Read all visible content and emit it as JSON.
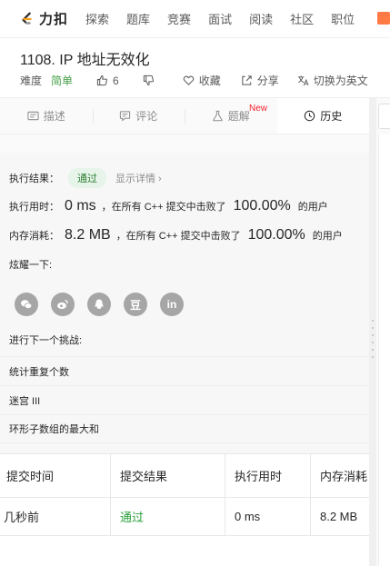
{
  "brand": {
    "name": "力扣"
  },
  "nav": {
    "items": [
      "探索",
      "题库",
      "竞赛",
      "面试",
      "阅读",
      "社区",
      "职位"
    ]
  },
  "problem": {
    "title": "1108. IP 地址无效化",
    "difficulty_label": "难度",
    "difficulty_value": "简单",
    "likes": "6",
    "favorite": "收藏",
    "share": "分享",
    "switch_lang": "切换为英文"
  },
  "tabs": [
    {
      "label": "描述",
      "icon": "description-icon"
    },
    {
      "label": "评论",
      "icon": "comment-icon"
    },
    {
      "label": "题解",
      "icon": "flask-icon",
      "badge": "New"
    },
    {
      "label": "历史",
      "icon": "clock-icon"
    }
  ],
  "result": {
    "status_label": "执行结果：",
    "status_value": "通过",
    "detail_link": "显示详情 ›",
    "runtime_label": "执行用时：",
    "runtime_value": "0 ms",
    "runtime_text": "，在所有 C++ 提交中击败了",
    "runtime_pct": "100.00%",
    "runtime_suffix": "的用户",
    "memory_label": "内存消耗：",
    "memory_value": "8.2 MB",
    "memory_text": "，在所有 C++ 提交中击败了",
    "memory_pct": "100.00%",
    "memory_suffix": "的用户",
    "share_label": "炫耀一下:",
    "share_icons": [
      "wechat-icon",
      "weibo-icon",
      "qq-icon",
      "douban-icon",
      "linkedin-icon"
    ],
    "douban_glyph": "豆",
    "linkedin_glyph": "in",
    "next_label": "进行下一个挑战:",
    "next_items": [
      "统计重复个数",
      "迷宫 III",
      "环形子数组的最大和"
    ]
  },
  "submissions": {
    "headers": [
      "提交时间",
      "提交结果",
      "执行用时",
      "内存消耗"
    ],
    "rows": [
      {
        "time": "几秒前",
        "result": "通过",
        "runtime": "0 ms",
        "memory": "8.2 MB"
      }
    ]
  },
  "colors": {
    "accent_green": "#43a047",
    "pass_green": "#2aa03b",
    "new_red": "#f5222d",
    "brand_orange": "#ffa116"
  }
}
